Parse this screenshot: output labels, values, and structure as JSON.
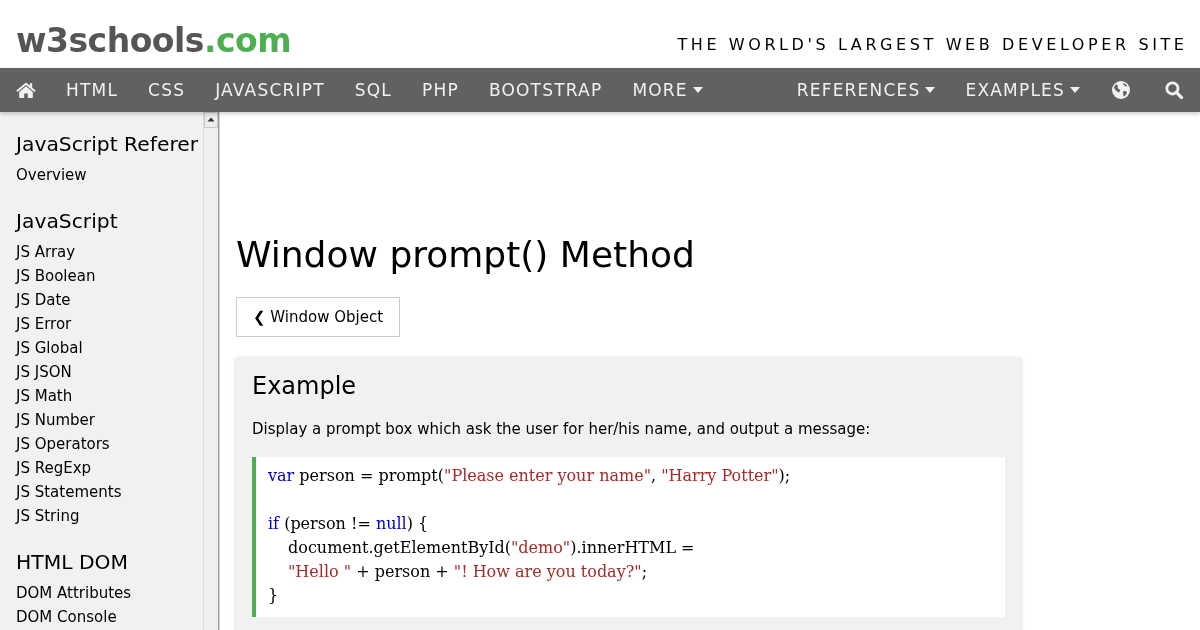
{
  "header": {
    "logo": {
      "name": "w3schools",
      "suffix": ".com"
    },
    "tagline": "THE WORLD'S LARGEST WEB DEVELOPER SITE"
  },
  "nav": {
    "links": [
      {
        "label": "HTML",
        "dropdown": false
      },
      {
        "label": "CSS",
        "dropdown": false
      },
      {
        "label": "JAVASCRIPT",
        "dropdown": false
      },
      {
        "label": "SQL",
        "dropdown": false
      },
      {
        "label": "PHP",
        "dropdown": false
      },
      {
        "label": "BOOTSTRAP",
        "dropdown": false
      },
      {
        "label": "MORE",
        "dropdown": true
      }
    ],
    "right_links": [
      {
        "label": "REFERENCES",
        "dropdown": true
      },
      {
        "label": "EXAMPLES",
        "dropdown": true
      }
    ]
  },
  "sidebar": {
    "sections": [
      {
        "heading": "JavaScript Referer",
        "items": [
          "Overview"
        ]
      },
      {
        "heading": "JavaScript",
        "items": [
          "JS Array",
          "JS Boolean",
          "JS Date",
          "JS Error",
          "JS Global",
          "JS JSON",
          "JS Math",
          "JS Number",
          "JS Operators",
          "JS RegExp",
          "JS Statements",
          "JS String"
        ]
      },
      {
        "heading": "HTML DOM",
        "items": [
          "DOM Attributes",
          "DOM Console"
        ]
      }
    ]
  },
  "page": {
    "title": "Window prompt() Method",
    "back_button": "❮ Window Object",
    "example": {
      "heading": "Example",
      "description": "Display a prompt box which ask the user for her/his name, and output a message:",
      "code_blocks": [
        [
          {
            "indented": false,
            "tokens": [
              {
                "kind": "keyword",
                "text": "var"
              },
              {
                "kind": "plain",
                "text": " person = prompt("
              },
              {
                "kind": "string",
                "text": "\"Please enter your name\""
              },
              {
                "kind": "plain",
                "text": ", "
              },
              {
                "kind": "string",
                "text": "\"Harry Potter\""
              },
              {
                "kind": "plain",
                "text": ");"
              }
            ]
          }
        ],
        [
          {
            "indented": false,
            "tokens": [
              {
                "kind": "keyword",
                "text": "if"
              },
              {
                "kind": "plain",
                "text": " (person != "
              },
              {
                "kind": "keyword",
                "text": "null"
              },
              {
                "kind": "plain",
                "text": ") {"
              }
            ]
          },
          {
            "indented": true,
            "tokens": [
              {
                "kind": "plain",
                "text": "document.getElementById("
              },
              {
                "kind": "string",
                "text": "\"demo\""
              },
              {
                "kind": "plain",
                "text": ").innerHTML ="
              }
            ]
          },
          {
            "indented": true,
            "tokens": [
              {
                "kind": "string",
                "text": "\"Hello \""
              },
              {
                "kind": "plain",
                "text": " + person + "
              },
              {
                "kind": "string",
                "text": "\"! How are you today?\""
              },
              {
                "kind": "plain",
                "text": ";"
              }
            ]
          },
          {
            "indented": false,
            "tokens": [
              {
                "kind": "plain",
                "text": "}"
              }
            ]
          }
        ]
      ]
    }
  }
}
